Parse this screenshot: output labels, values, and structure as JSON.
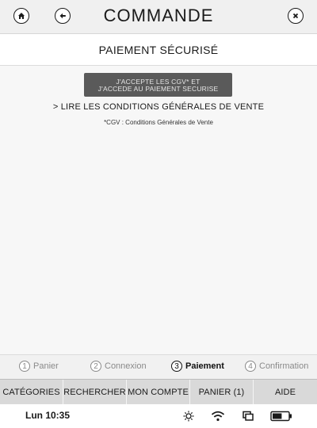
{
  "header": {
    "title": "COMMANDE",
    "home_icon": "home-icon",
    "back_icon": "back-arrow-icon",
    "close_icon": "close-icon"
  },
  "subheader": {
    "title": "PAIEMENT SÉCURISÉ"
  },
  "content": {
    "accept_button": {
      "line1": "J'ACCEPTE LES CGV* ET",
      "line2": "J'ACCEDE AU PAIEMENT SECURISE"
    },
    "cgv_link": "> LIRE LES CONDITIONS GÉNÉRALES DE VENTE",
    "cgv_note": "*CGV : Conditions Générales de Vente"
  },
  "steps": [
    {
      "num": "1",
      "label": "Panier",
      "active": false
    },
    {
      "num": "2",
      "label": "Connexion",
      "active": false
    },
    {
      "num": "3",
      "label": "Paiement",
      "active": true
    },
    {
      "num": "4",
      "label": "Confirmation",
      "active": false
    }
  ],
  "tabs": [
    {
      "label": "CATÉGORIES"
    },
    {
      "label": "RECHERCHER"
    },
    {
      "label": "MON COMPTE"
    },
    {
      "label": "PANIER (1)"
    },
    {
      "label": "AIDE"
    }
  ],
  "status": {
    "time": "Lun 10:35",
    "icons": [
      "brightness-icon",
      "wifi-icon",
      "sync-icon",
      "battery-icon"
    ],
    "battery_level": 0.6
  },
  "colors": {
    "button_bg": "#5a5a5a",
    "topbar_bg": "#f0f0f0",
    "tabs_bg": "#d9d9d9"
  }
}
